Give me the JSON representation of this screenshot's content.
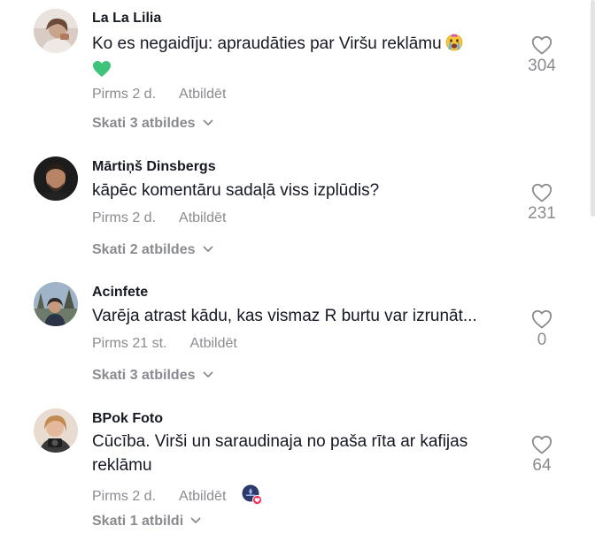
{
  "comments": [
    {
      "username": "La La Lilia",
      "text": "Ko es negaidīju: apraudāties par Viršu reklāmu",
      "time": "Pirms 2 d.",
      "reply_label": "Atbildēt",
      "replies_label": "Skati 3 atbildes",
      "likes": "304",
      "emojis": [
        "crying-face-emoji",
        "green-heart-emoji"
      ]
    },
    {
      "username": "Mārtiņš Dinsbergs",
      "text": "kāpēc komentāru sadaļā viss izplūdis?",
      "time": "Pirms 2 d.",
      "reply_label": "Atbildēt",
      "replies_label": "Skati 2 atbildes",
      "likes": "231"
    },
    {
      "username": "Acinfete",
      "text": "Varēja atrast kādu, kas vismaz R burtu var izrunāt...",
      "time": "Pirms 21 st.",
      "reply_label": "Atbildēt",
      "replies_label": "Skati 3 atbildes",
      "likes": "0"
    },
    {
      "username": "BPok Foto",
      "text": "Cūcība. Virši un saraudinaja no paša rīta ar kafijas reklāmu",
      "time": "Pirms 2 d.",
      "reply_label": "Atbildēt",
      "replies_label": "Skati 1 atbildi",
      "likes": "64",
      "creator_liked": true
    }
  ],
  "colors": {
    "text": "#161823",
    "muted": "#8a8b91",
    "liked_badge": "#fe2c55"
  }
}
